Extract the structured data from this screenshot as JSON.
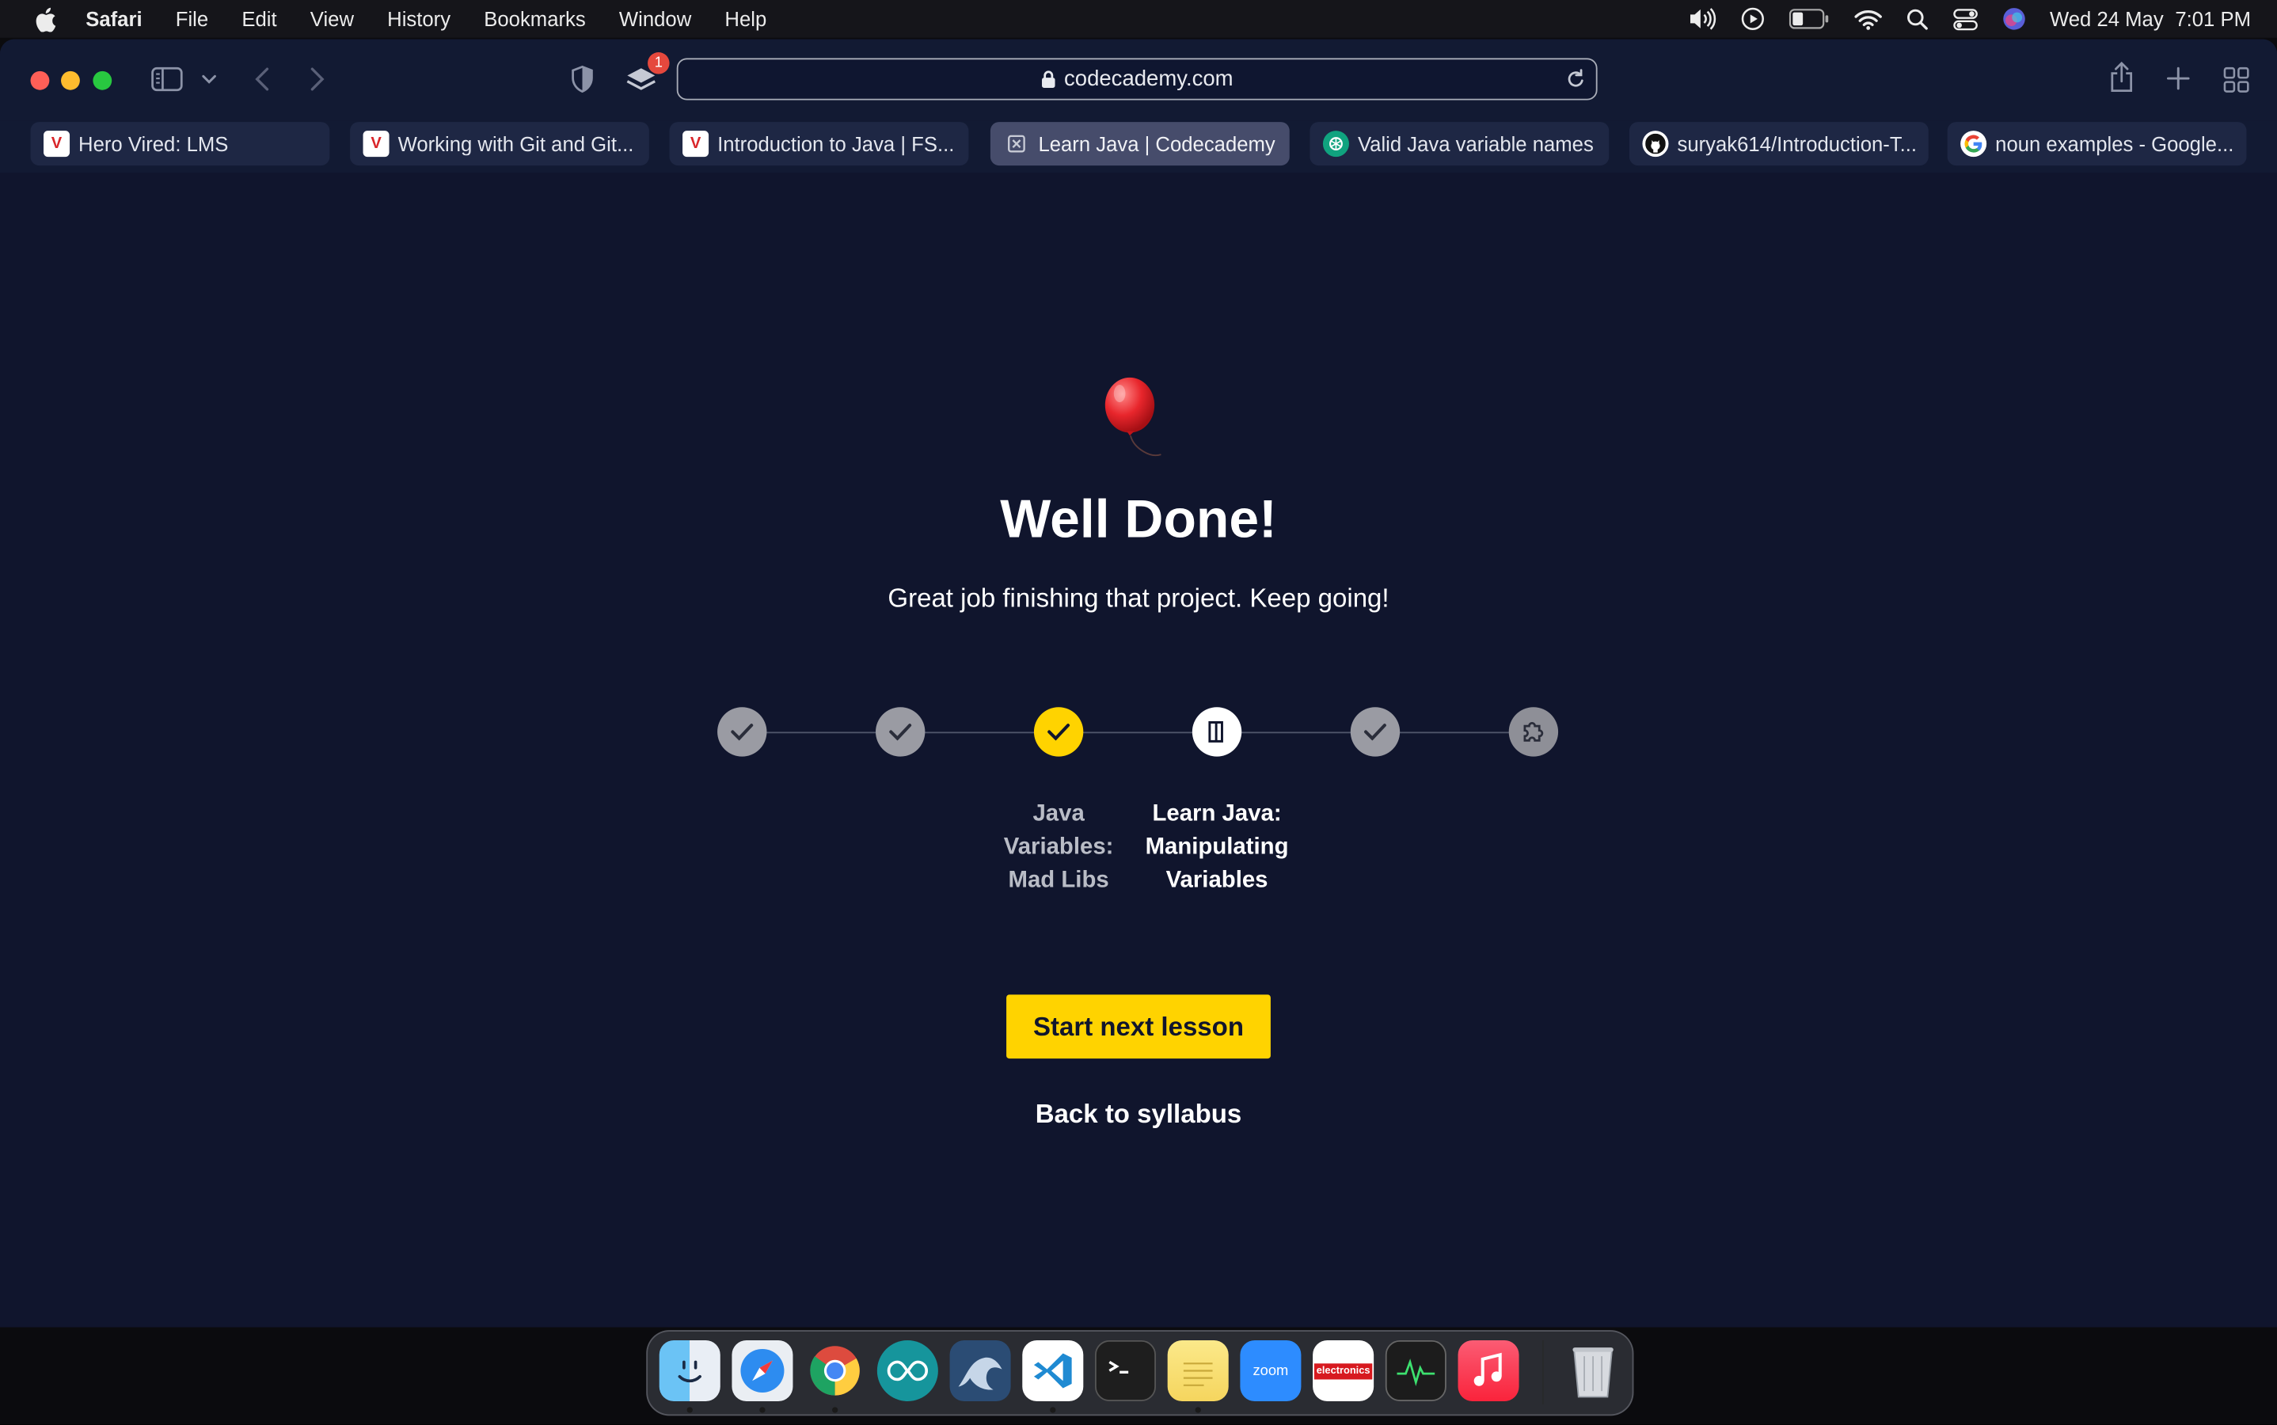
{
  "menubar": {
    "app_name": "Safari",
    "items": [
      "File",
      "Edit",
      "View",
      "History",
      "Bookmarks",
      "Window",
      "Help"
    ],
    "date": "Wed 24 May",
    "time": "7:01 PM"
  },
  "browser": {
    "url": "codecademy.com",
    "tab_badge": "1",
    "tabs": [
      {
        "title": "Hero Vired: LMS",
        "favicon": "herovired-icon"
      },
      {
        "title": "Working with Git and Git...",
        "favicon": "herovired-icon"
      },
      {
        "title": "Introduction to Java | FS...",
        "favicon": "herovired-icon"
      },
      {
        "title": "Learn Java | Codecademy",
        "favicon": "codecademy-icon",
        "active": true
      },
      {
        "title": "Valid Java variable names",
        "favicon": "chatgpt-icon"
      },
      {
        "title": "suryak614/Introduction-T...",
        "favicon": "github-icon"
      },
      {
        "title": "noun examples - Google...",
        "favicon": "google-icon"
      }
    ]
  },
  "page": {
    "title": "Well Done!",
    "subtitle": "Great job finishing that project. Keep going!",
    "steps": [
      {
        "status": "done",
        "icon": "check-icon"
      },
      {
        "status": "done",
        "icon": "check-icon"
      },
      {
        "status": "current",
        "icon": "check-icon",
        "label_lines": [
          "Java",
          "Variables:",
          "Mad Libs"
        ]
      },
      {
        "status": "next",
        "icon": "article-icon",
        "label_lines": [
          "Learn Java:",
          "Manipulating",
          "Variables"
        ]
      },
      {
        "status": "done",
        "icon": "check-icon"
      },
      {
        "status": "locked",
        "icon": "puzzle-icon"
      }
    ],
    "primary_button": "Start next lesson",
    "secondary_link": "Back to syllabus"
  },
  "dock": {
    "apps": [
      "Finder",
      "Safari",
      "Google Chrome",
      "Arduino",
      "MySQL Workbench",
      "Visual Studio Code",
      "Terminal",
      "Notes",
      "zoom",
      "Electronics",
      "Activity Monitor",
      "Music",
      "Trash"
    ],
    "zoom_label": "zoom",
    "electronics_label": "electronics"
  },
  "colors": {
    "accent": "#ffd300",
    "page_bg": "#10152d",
    "text": "#ffffff"
  }
}
